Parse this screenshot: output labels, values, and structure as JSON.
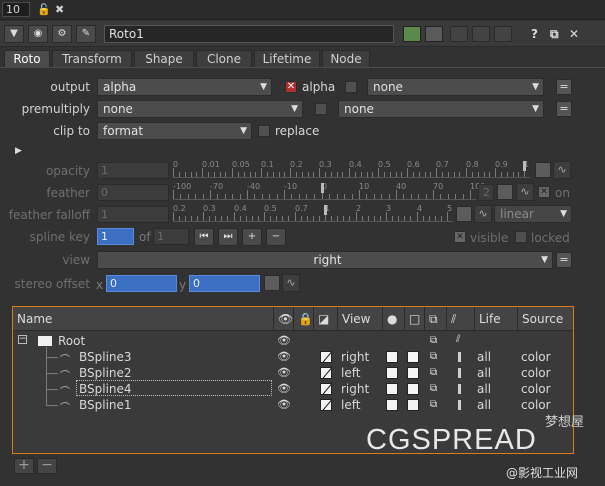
{
  "top": {
    "frame_number": "10",
    "lock_icon": "lock-icon",
    "close_icon": "close-icon"
  },
  "title": {
    "node_name": "Roto1",
    "help": "?",
    "float": "⧉",
    "close": "✕"
  },
  "tabs": [
    "Roto",
    "Transform",
    "Shape",
    "Clone",
    "Lifetime",
    "Node"
  ],
  "active_tab": "Roto",
  "output": {
    "label": "output",
    "value": "alpha",
    "alpha_checkbox_label": "alpha",
    "second_value": "none"
  },
  "premultiply": {
    "label": "premultiply",
    "value": "none",
    "second_value": "none"
  },
  "clip_to": {
    "label": "clip to",
    "value": "format",
    "replace_label": "replace"
  },
  "opacity": {
    "label": "opacity",
    "value": "1",
    "ticks": [
      "0",
      "0.01",
      "0.05",
      "0.1",
      "0.2",
      "0.3",
      "0.4",
      "0.5",
      "0.6",
      "0.7",
      "0.8",
      "0.9",
      "1"
    ]
  },
  "feather": {
    "label": "feather",
    "value": "0",
    "ticks": [
      "-100",
      "-70",
      "-40",
      "-10",
      "0",
      "10",
      "40",
      "70",
      "100"
    ],
    "count": "2",
    "on_label": "on"
  },
  "feather_falloff": {
    "label": "feather falloff",
    "value": "1",
    "ticks": [
      "0.2",
      "0.3",
      "0.4",
      "0.5",
      "0.7",
      "1",
      "2",
      "3",
      "4",
      "5"
    ],
    "mode": "linear"
  },
  "spline_key": {
    "label": "spline key",
    "value": "1",
    "of_label": "of",
    "total": "1",
    "visible_label": "visible",
    "locked_label": "locked"
  },
  "view": {
    "label": "view",
    "value": "right"
  },
  "stereo_offset": {
    "label": "stereo offset",
    "x_label": "x",
    "x_value": "0",
    "y_label": "y",
    "y_value": "0"
  },
  "tree": {
    "columns": [
      "Name",
      "View",
      "Life",
      "Source"
    ],
    "root": "Root",
    "items": [
      {
        "name": "BSpline3",
        "view": "right",
        "life": "all",
        "source": "color"
      },
      {
        "name": "BSpline2",
        "view": "left",
        "life": "all",
        "source": "color"
      },
      {
        "name": "BSpline4",
        "view": "right",
        "life": "all",
        "source": "color"
      },
      {
        "name": "BSpline1",
        "view": "left",
        "life": "all",
        "source": "color"
      }
    ]
  },
  "buttons": {
    "add": "+",
    "remove": "−"
  },
  "watermark": {
    "main": "CGSPREAD",
    "sub": "梦想屋",
    "bottom": "@影视工业网"
  },
  "colors": {
    "accent": "#d97d1a",
    "field_blue": "#3a6fc4",
    "active_green": "#5a8a4a"
  }
}
